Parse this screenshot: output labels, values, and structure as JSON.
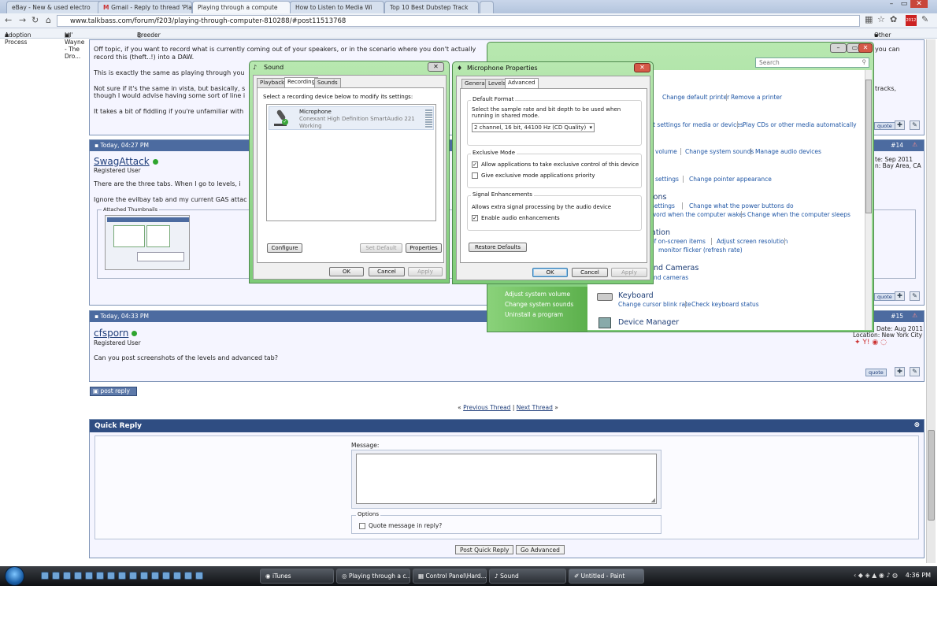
{
  "browser": {
    "tabs": [
      "eBay - New & used electro",
      "Gmail - Reply to thread 'Pla",
      "Playing through a compute",
      "How to Listen to Media Wi",
      "Top 10 Best Dubstep Track"
    ],
    "url": "www.talkbass.com/forum/f203/playing-through-computer-810288/#post11513768",
    "bookmarks": [
      "Adoption Process",
      "Lil' Wayne - The Dro...",
      "Breeder List"
    ],
    "other_bookmarks": "Other bookmarks",
    "year_badge": "2012"
  },
  "posts": {
    "p13": {
      "text1": "Off topic, if you want to record what is currently coming out of your speakers, or in the scenario where you don't actually",
      "text1_tail": "you can",
      "text2": "record this (theft..!) into a DAW.",
      "text3": "This is exactly the same as playing through you",
      "text4": "Not sure if it's the same in vista, but basically, s",
      "text4_tail": "tracks,",
      "text5": "though I would advise having some sort of line i",
      "text6": "It takes a bit of fiddling if you're unfamiliar with"
    },
    "p14": {
      "date": "Today, 04:27 PM",
      "num": "#14",
      "user": "SwagAttack",
      "title": "Registered User",
      "join": "te: Sep 2011",
      "location": "n: Bay Area, CA",
      "text1": "There are the three tabs. When I go to levels, i",
      "text2": "Ignore the evilbay tab and my current GAS attac",
      "thumbs_label": "Attached Thumbnails"
    },
    "p15": {
      "date": "Today, 04:33 PM",
      "num": "#15",
      "user": "cfsporn",
      "title": "Registered User",
      "join": "Join Date: Aug 2011",
      "location": "Location: New York City",
      "text": "Can you post screenshots of the levels and advanced tab?"
    },
    "quote_label": "quote"
  },
  "page": {
    "post_reply": "post reply",
    "thread_nav_open": "«",
    "prev_thread": "Previous Thread",
    "sep": "|",
    "next_thread": "Next Thread",
    "thread_nav_close": "»",
    "quick_reply_title": "Quick Reply",
    "message_label": "Message:",
    "options_label": "Options",
    "quote_checkbox": "Quote message in reply?",
    "post_quick_reply": "Post Quick Reply",
    "go_advanced": "Go Advanced"
  },
  "sound_dialog": {
    "title": "Sound",
    "tabs": [
      "Playback",
      "Recording",
      "Sounds"
    ],
    "instruction": "Select a recording device below to modify its settings:",
    "device_name": "Microphone",
    "device_desc": "Conexant High Definition SmartAudio 221",
    "device_status": "Working",
    "configure": "Configure",
    "set_default": "Set Default",
    "properties": "Properties",
    "ok": "OK",
    "cancel": "Cancel",
    "apply": "Apply"
  },
  "mic_dialog": {
    "title": "Microphone Properties",
    "tabs": [
      "General",
      "Levels",
      "Advanced"
    ],
    "default_format_label": "Default Format",
    "default_format_desc": "Select the sample rate and bit depth to be used when running in shared mode.",
    "format_value": "2 channel, 16 bit, 44100 Hz (CD Quality)",
    "exclusive_label": "Exclusive Mode",
    "exclusive_1": "Allow applications to take exclusive control of this device",
    "exclusive_2": "Give exclusive mode applications priority",
    "signal_label": "Signal Enhancements",
    "signal_desc": "Allows extra signal processing by the audio device",
    "signal_enable": "Enable audio enhancements",
    "restore": "Restore Defaults",
    "ok": "OK",
    "cancel": "Cancel",
    "apply": "Apply"
  },
  "control_panel": {
    "search_placeholder": "Search",
    "links": {
      "default_printer": "Change default printer",
      "remove_printer": "Remove a printer",
      "media_settings": "lt settings for media or devices",
      "play_cds": "Play CDs or other media automatically",
      "volume": "volume",
      "system_sounds": "Change system sounds",
      "manage_audio": "Manage audio devices",
      "mouse_settings": "settings",
      "pointer_appearance": "Change pointer appearance",
      "power_options_head": "ions",
      "power_buttons": "Change what the power buttons do",
      "battery_settings": "settings",
      "password_wake": "word when the computer wakes",
      "computer_sleeps": "Change when the computer sleeps",
      "personalization_head": "ation",
      "onscreen_items": "ize of on-screen items",
      "screen_resolution": "Adjust screen resolution",
      "monitor_flicker": "monitor flicker (refresh rate)",
      "scanners_head": "nd Cameras",
      "scanners_link": "nd cameras",
      "keyboard_head": "Keyboard",
      "cursor_blink": "Change cursor blink rate",
      "keyboard_status": "Check keyboard status",
      "device_manager": "Device Manager"
    },
    "left": [
      "Adjust system volume",
      "Change system sounds",
      "Uninstall a program"
    ]
  },
  "taskbar": {
    "items": [
      "iTunes",
      "Playing through a c...",
      "Control Panel\\Hard...",
      "Sound",
      "Untitled - Paint"
    ],
    "clock": "4:36 PM"
  }
}
